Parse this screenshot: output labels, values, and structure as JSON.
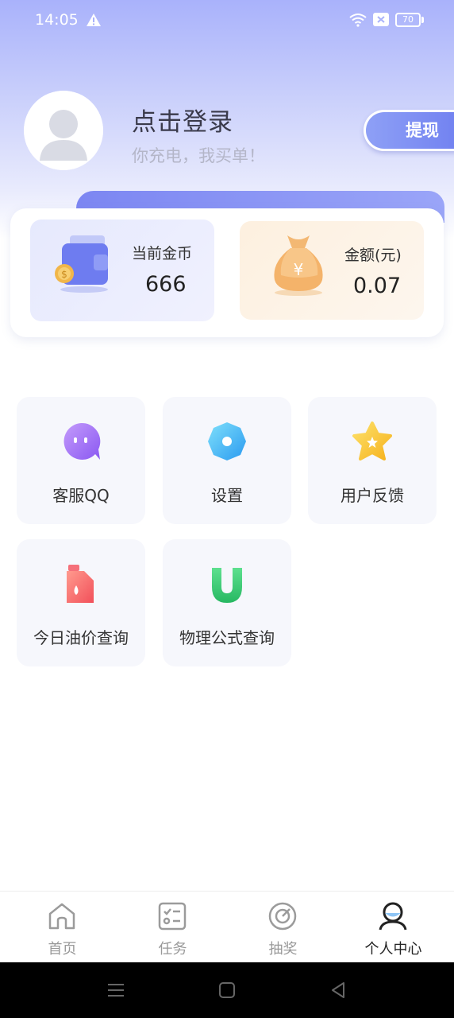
{
  "status_bar": {
    "time": "14:05",
    "battery": "70"
  },
  "profile": {
    "title": "点击登录",
    "subtitle": "你充电，我买单！"
  },
  "withdraw_button": "提现",
  "wallet": {
    "coins": {
      "label": "当前金币",
      "value": "666"
    },
    "money": {
      "label": "金额(元)",
      "value": "0.07"
    }
  },
  "grid": [
    {
      "label": "客服QQ",
      "icon": "chat-bubble-icon"
    },
    {
      "label": "设置",
      "icon": "gear-icon"
    },
    {
      "label": "用户反馈",
      "icon": "star-icon"
    },
    {
      "label": "今日油价查询",
      "icon": "oil-can-icon"
    },
    {
      "label": "物理公式查询",
      "icon": "magnet-icon"
    }
  ],
  "tabs": [
    {
      "label": "首页",
      "icon": "home-icon"
    },
    {
      "label": "任务",
      "icon": "task-list-icon"
    },
    {
      "label": "抽奖",
      "icon": "lottery-icon"
    },
    {
      "label": "个人中心",
      "icon": "user-icon"
    }
  ],
  "colors": {
    "accent": "#7c86f2",
    "header_top": "#a9b2fb"
  }
}
